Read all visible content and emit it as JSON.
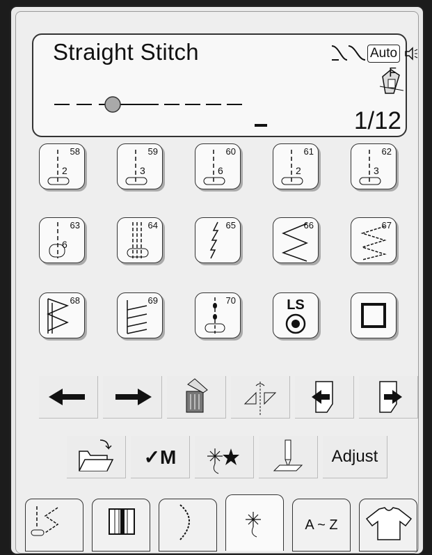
{
  "display": {
    "stitch_name": "Straight Stitch",
    "thread_mode": "Auto",
    "presser_foot": "F",
    "page_indicator": "1/12"
  },
  "stitches": [
    {
      "number": "58",
      "inner": "2"
    },
    {
      "number": "59",
      "inner": "3"
    },
    {
      "number": "60",
      "inner": "6"
    },
    {
      "number": "61",
      "inner": "2"
    },
    {
      "number": "62",
      "inner": "3"
    },
    {
      "number": "63",
      "inner": "6"
    },
    {
      "number": "64"
    },
    {
      "number": "65"
    },
    {
      "number": "66"
    },
    {
      "number": "67"
    },
    {
      "number": "68"
    },
    {
      "number": "69"
    },
    {
      "number": "70"
    },
    {
      "label": "LS"
    },
    {
      "icon": "square-outline-icon"
    }
  ],
  "toolbar": {
    "memory_label": "✓M",
    "adjust_label": "Adjust"
  },
  "tabs": {
    "alpha_label": "A ~ Z"
  }
}
